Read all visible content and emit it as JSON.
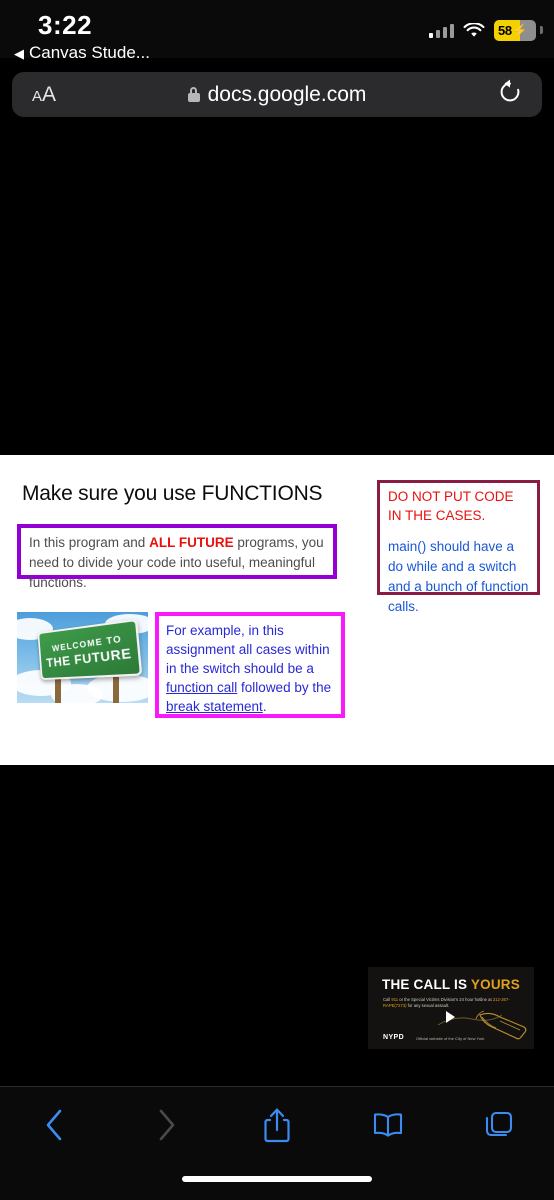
{
  "statusbar": {
    "time": "3:22",
    "battery_percent": "58",
    "battery_bolt": "⚡",
    "signal_icon": "cellular-signal-icon",
    "wifi_icon": "wifi-icon"
  },
  "back_link": {
    "caret": "◀",
    "label": "Canvas Stude..."
  },
  "addressbar": {
    "aa_small": "A",
    "aa_big": "A",
    "lock_icon": "lock-icon",
    "url": "docs.google.com",
    "reload_icon": "reload-icon"
  },
  "slide": {
    "title": "Make sure you use FUNCTIONS",
    "purple_box": {
      "text_before": "In this program and ",
      "emphasis": "ALL FUTURE",
      "text_after": " programs, you need to divide your code into useful, meaningful functions.",
      "border_color": "#9400d3"
    },
    "magenta_box": {
      "line_start": "For example, in this assignment all cases within in the switch should be a ",
      "link1": "function call",
      "middle": " followed by the ",
      "link2": "break statement",
      "end": ".",
      "border_color": "#fa19fa"
    },
    "darkred_box": {
      "heading": "DO NOT PUT CODE IN THE CASES.",
      "body_1": "main() should have a ",
      "kw1": "do while",
      "body_2": " and a ",
      "kw2": "switch",
      "body_3": " and a bunch of ",
      "kw3": "function calls",
      "body_4": ".",
      "border_color": "#8a1c43"
    },
    "sign_image": {
      "name": "welcome-to-the-future-sign",
      "line1": "WELCOME TO",
      "line2": "THE FUTURE"
    },
    "nypd_image": {
      "name": "nypd-the-call-is-yours-banner",
      "headline_1": "THE CALL IS ",
      "headline_2": "YOURS",
      "subtext_1": "Call ",
      "subtext_hl1": "911",
      "subtext_2": " or the Special Victims Division's  24 hour hotline at ",
      "subtext_hl2": "212-267-RAPE(7273)",
      "subtext_3": " for any sexual assault.",
      "logo": "NYPD",
      "logo_sub": "Official website of the City of New York"
    }
  },
  "toolbar": {
    "back_icon": "chevron-left-icon",
    "forward_icon": "chevron-right-icon",
    "share_icon": "share-icon",
    "bookmarks_icon": "book-icon",
    "tabs_icon": "tabs-icon"
  }
}
